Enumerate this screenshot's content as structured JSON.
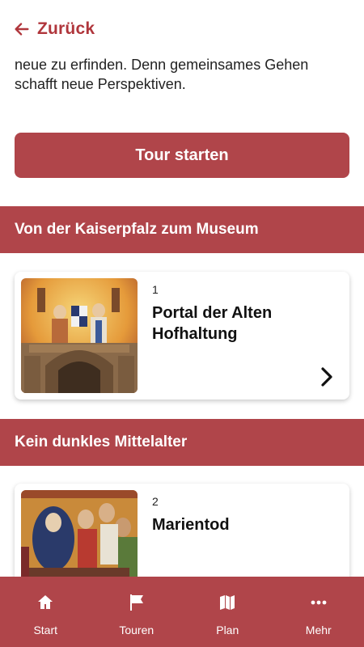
{
  "header": {
    "back_label": "Zurück"
  },
  "intro": {
    "text": "neue zu erfinden. Denn gemeinsames Gehen schafft neue Perspektiven."
  },
  "tour_button": {
    "label": "Tour starten"
  },
  "sections": [
    {
      "title": "Von der Kaiserpfalz zum Museum",
      "card": {
        "number": "1",
        "title": "Portal der Alten Hofhaltung",
        "icon": "chevron-right-icon"
      }
    },
    {
      "title": "Kein dunkles Mittelalter",
      "card": {
        "number": "2",
        "title": "Marientod"
      }
    }
  ],
  "nav": [
    {
      "label": "Start",
      "icon": "home-icon"
    },
    {
      "label": "Touren",
      "icon": "flag-icon"
    },
    {
      "label": "Plan",
      "icon": "map-icon"
    },
    {
      "label": "Mehr",
      "icon": "more-dots-icon"
    }
  ],
  "colors": {
    "accent": "#b0454a",
    "accent_text": "#b0363c"
  }
}
